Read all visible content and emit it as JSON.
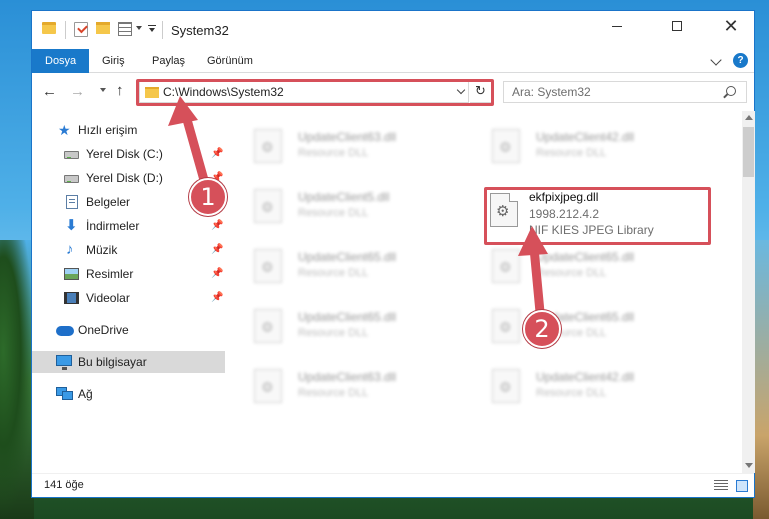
{
  "window": {
    "title": "System32",
    "close_glyph": "✕"
  },
  "ribbon": {
    "tabs": [
      "Dosya",
      "Giriş",
      "Paylaş",
      "Görünüm"
    ],
    "help": "?"
  },
  "nav": {
    "back": "←",
    "forward": "→",
    "up": "↑",
    "address": "C:\\Windows\\System32",
    "refresh": "↻",
    "search_placeholder": "Ara: System32"
  },
  "sidebar": {
    "items": [
      {
        "label": "Hızlı erişim",
        "icon": "star-icon"
      },
      {
        "label": "Yerel Disk (C:)",
        "icon": "disk-icon",
        "pinned": true
      },
      {
        "label": "Yerel Disk (D:)",
        "icon": "disk-icon",
        "pinned": true
      },
      {
        "label": "Belgeler",
        "icon": "documents-icon",
        "pinned": true
      },
      {
        "label": "İndirmeler",
        "icon": "download-icon",
        "pinned": true
      },
      {
        "label": "Müzik",
        "icon": "music-icon",
        "pinned": true
      },
      {
        "label": "Resimler",
        "icon": "pictures-icon",
        "pinned": true
      },
      {
        "label": "Videolar",
        "icon": "videos-icon",
        "pinned": true
      },
      {
        "label": "OneDrive",
        "icon": "onedrive-icon"
      },
      {
        "label": "Bu bilgisayar",
        "icon": "this-pc-icon",
        "selected": true
      },
      {
        "label": "Ağ",
        "icon": "network-icon"
      }
    ],
    "pin_glyph": "📌"
  },
  "files": [
    {
      "name": "UpdateClient63.dll",
      "desc": "Resource DLL"
    },
    {
      "name": "UpdateClient42.dll",
      "desc": "Resource DLL"
    },
    {
      "name": "UpdateClient5.dll",
      "desc": "Resource DLL"
    },
    {
      "name": "UpdateClient65.dll",
      "desc": "Resource DLL"
    },
    {
      "name": "UpdateClient65.dll",
      "desc": "Resource DLL"
    },
    {
      "name": "UpdateClient65.dll",
      "desc": "Resource DLL"
    },
    {
      "name": "UpdateClient65.dll",
      "desc": "Resource DLL"
    },
    {
      "name": "UpdateClient63.dll",
      "desc": "Resource DLL"
    },
    {
      "name": "UpdateClient42.dll",
      "desc": "Resource DLL"
    }
  ],
  "highlighted_file": {
    "name": "ekfpixjpeg.dll",
    "version": "1998.212.4.2",
    "description": "NIF KIES JPEG Library"
  },
  "status": {
    "count": "141 öğe"
  },
  "annotations": {
    "step1": "1",
    "step2": "2",
    "color": "#d6505a"
  }
}
